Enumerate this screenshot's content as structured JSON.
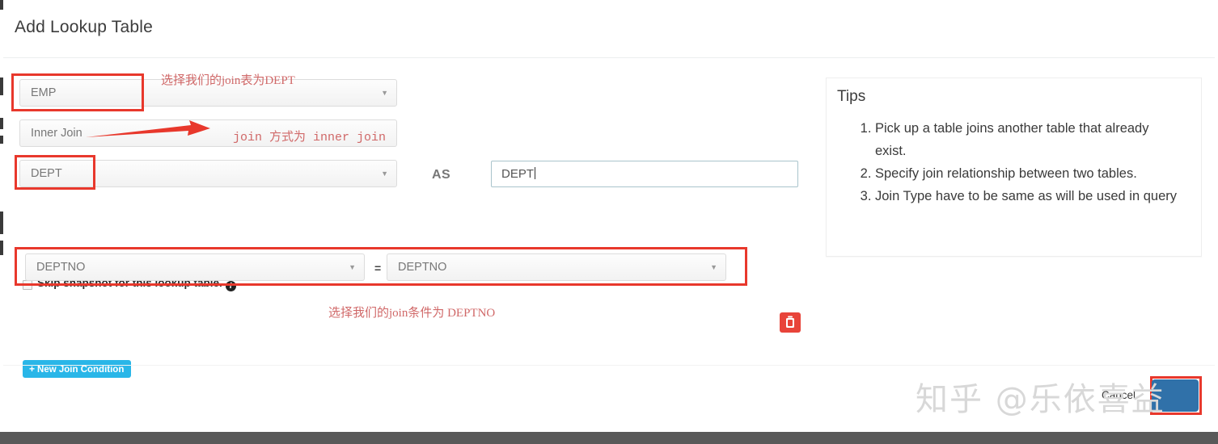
{
  "modal": {
    "title": "Add Lookup Table",
    "source_table": {
      "value": "EMP",
      "caret": "▼"
    },
    "join_type": {
      "value": "Inner Join"
    },
    "lookup_table": {
      "value": "DEPT",
      "caret": "▼"
    },
    "as_label": "AS",
    "alias_input": {
      "value": "DEPT",
      "placeholder": ""
    },
    "skip_snapshot": {
      "label": "Skip snapshot for this lookup table.",
      "info_glyph": "i",
      "checked": false
    },
    "join_condition": {
      "left": {
        "value": "DEPTNO",
        "caret": "▼"
      },
      "operator": "=",
      "right": {
        "value": "DEPTNO",
        "caret": "▼"
      },
      "delete_icon": "trash-icon"
    },
    "new_join_condition_button": {
      "plus": "➕",
      "label": "New Join Condition"
    }
  },
  "tips": {
    "title": "Tips",
    "items": [
      "Pick up a table joins another table that already exist.",
      "Specify join relationship between two tables.",
      "Join Type have to be same as will be used in query"
    ]
  },
  "footer": {
    "cancel_label": "Cancel",
    "save_label": ""
  },
  "annotations": {
    "note_table": "选择我们的join表为DEPT",
    "note_jointype": "join 方式为 inner  join",
    "note_condition": "选择我们的join条件为  DEPTNO"
  },
  "watermark": {
    "text": "知乎 @乐依喜益"
  },
  "colors": {
    "highlight_red": "#e8382c",
    "annotation_red": "#cd5c5c",
    "primary_blue": "#29b6e8",
    "danger_red": "#e8443a",
    "save_blue": "#3071a9",
    "bottom_strip": "#595959"
  }
}
